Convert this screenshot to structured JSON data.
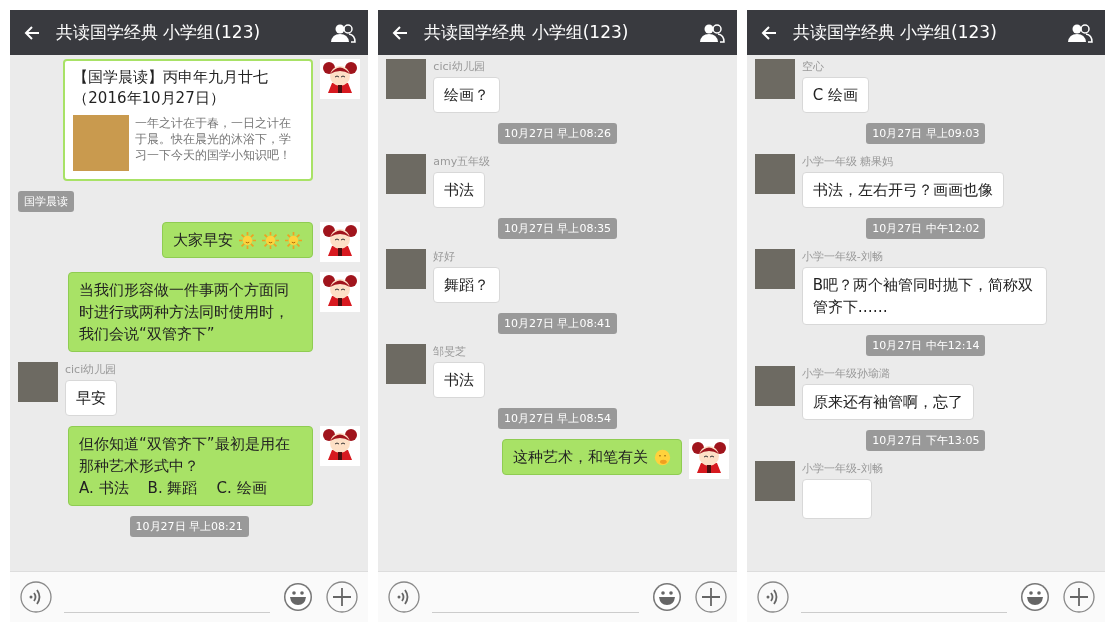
{
  "panels": [
    {
      "title": "共读国学经典 小学组(123)",
      "messages": [
        {
          "kind": "card",
          "outgoing": true,
          "title": "【国学晨读】丙申年九月廿七（2016年10月27日）",
          "description": "一年之计在于春，一日之计在于晨。快在晨光的沐浴下，学习一下今天的国学小知识吧！"
        },
        {
          "kind": "tag",
          "text": "国学晨读"
        },
        {
          "kind": "text",
          "outgoing": true,
          "text": "大家早安",
          "emojis": [
            {
              "kind": "sun"
            },
            {
              "kind": "sun"
            },
            {
              "kind": "sun"
            }
          ]
        },
        {
          "kind": "text",
          "outgoing": true,
          "text": "当我们形容做一件事两个方面同时进行或两种方法同时使用时，我们会说“双管齐下”"
        },
        {
          "kind": "text",
          "outgoing": false,
          "sender": "cici幼儿园",
          "text": "早安"
        },
        {
          "kind": "text",
          "outgoing": true,
          "text": "但你知道“双管齐下”最初是用在那种艺术形式中？\nA. 书法    B. 舞蹈    C. 绘画"
        },
        {
          "kind": "time",
          "text": "10月27日 早上08:21"
        }
      ]
    },
    {
      "title": "共读国学经典 小学组(123)",
      "messages": [
        {
          "kind": "text",
          "outgoing": false,
          "sender": "cici幼儿园",
          "text": "绘画？"
        },
        {
          "kind": "time",
          "text": "10月27日 早上08:26"
        },
        {
          "kind": "text",
          "outgoing": false,
          "sender": "amy五年级",
          "text": "书法"
        },
        {
          "kind": "time",
          "text": "10月27日 早上08:35"
        },
        {
          "kind": "text",
          "outgoing": false,
          "sender": "好好",
          "text": "舞蹈？"
        },
        {
          "kind": "time",
          "text": "10月27日 早上08:41"
        },
        {
          "kind": "text",
          "outgoing": false,
          "sender": "邹旻芝",
          "text": "书法"
        },
        {
          "kind": "time",
          "text": "10月27日 早上08:54"
        },
        {
          "kind": "text",
          "outgoing": true,
          "text": "这种艺术，和笔有关",
          "emojis": [
            {
              "kind": "thinking"
            }
          ]
        }
      ]
    },
    {
      "title": "共读国学经典 小学组(123)",
      "messages": [
        {
          "kind": "text",
          "outgoing": false,
          "sender": "空心",
          "text": "C 绘画"
        },
        {
          "kind": "time",
          "text": "10月27日 早上09:03"
        },
        {
          "kind": "text",
          "outgoing": false,
          "sender": "小学一年级 糖果妈",
          "text": "书法，左右开弓？画画也像"
        },
        {
          "kind": "time",
          "text": "10月27日 中午12:02"
        },
        {
          "kind": "text",
          "outgoing": false,
          "sender": "小学一年级-刘畅",
          "text": "B吧？两个袖管同时抛下，简称双管齐下……"
        },
        {
          "kind": "time",
          "text": "10月27日 中午12:14"
        },
        {
          "kind": "text",
          "outgoing": false,
          "sender": "小学一年级孙瑜潞",
          "text": "原来还有袖管啊，忘了"
        },
        {
          "kind": "time",
          "text": "10月27日 下午13:05"
        },
        {
          "kind": "text",
          "outgoing": false,
          "sender": "小学一年级-刘畅"
        }
      ]
    }
  ]
}
